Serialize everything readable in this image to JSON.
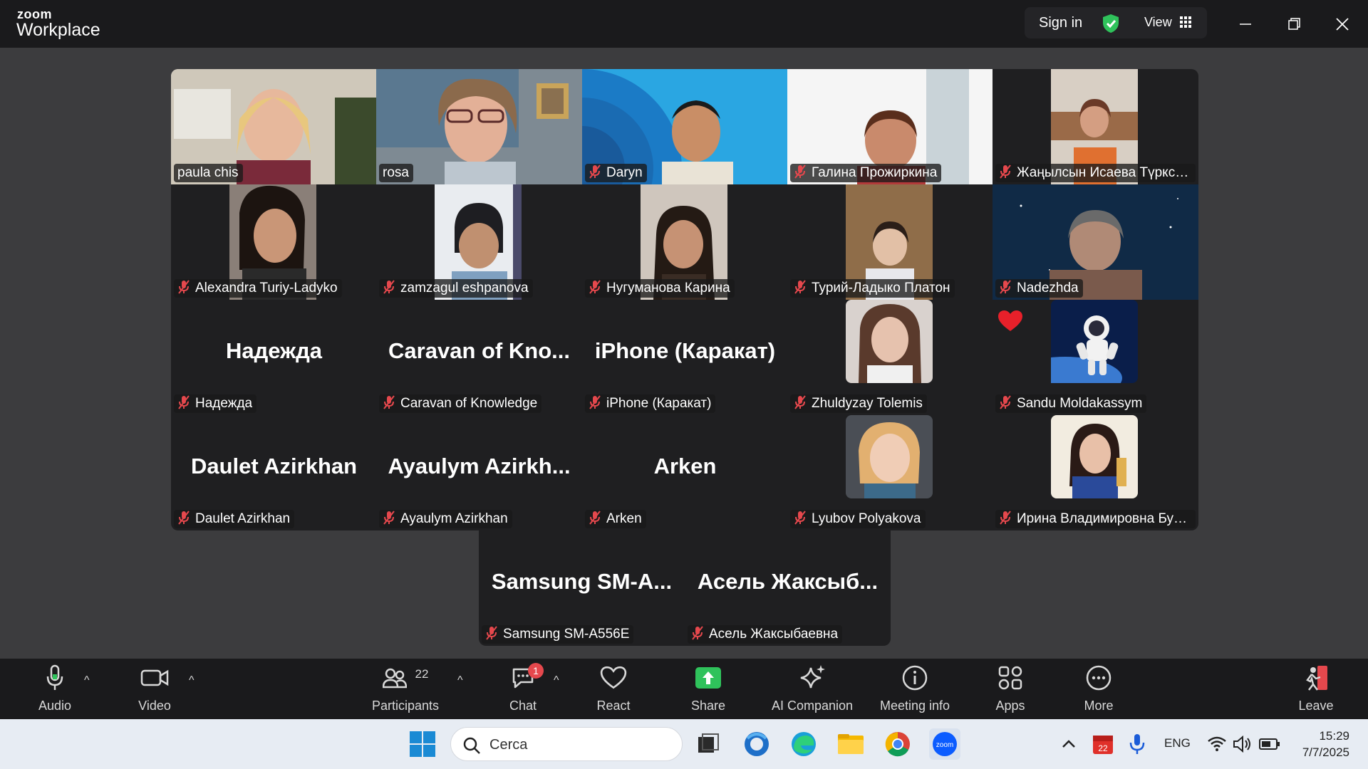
{
  "app": {
    "brand_small": "zoom",
    "brand_large": "Workplace",
    "sign_in": "Sign in",
    "view": "View"
  },
  "participants": [
    {
      "tile": "paula chis",
      "label": "paula chis",
      "muted": false,
      "video": true
    },
    {
      "tile": "rosa",
      "label": "rosa",
      "muted": false,
      "video": true,
      "active_speaker": true
    },
    {
      "tile": "Daryn",
      "label": "Daryn",
      "muted": true,
      "video": true
    },
    {
      "tile": "Галина Прожиркина",
      "label": "Галина Прожиркина",
      "muted": true,
      "video": true
    },
    {
      "tile": "Жаңылсын Исаева Түркси...",
      "label": "Жаңылсын Исаева Түркси...",
      "muted": true,
      "video": true
    },
    {
      "tile": "Alexandra Turiy-Ladyko",
      "label": "Alexandra Turiy-Ladyko",
      "muted": true,
      "video": true
    },
    {
      "tile": "zamzagul eshpanova",
      "label": "zamzagul eshpanova",
      "muted": true,
      "video": true
    },
    {
      "tile": "Нугуманова Карина",
      "label": "Нугуманова Карина",
      "muted": true,
      "video": true
    },
    {
      "tile": "Турий-Ладыко Платон",
      "label": "Турий-Ладыко Платон",
      "muted": true,
      "video": true
    },
    {
      "tile": "Nadezhda",
      "label": "Nadezhda",
      "muted": true,
      "video": true
    },
    {
      "tile": "Надежда",
      "label": "Надежда",
      "muted": true,
      "video": false
    },
    {
      "tile": "Caravan of Kno...",
      "label": "Caravan of Knowledge",
      "muted": true,
      "video": false
    },
    {
      "tile": "iPhone (Каракат)",
      "label": "iPhone (Каракат)",
      "muted": true,
      "video": false
    },
    {
      "tile": "Zhuldyzay Tolemis",
      "label": "Zhuldyzay Tolemis",
      "muted": true,
      "video": true
    },
    {
      "tile": "Sandu Moldakassym",
      "label": "Sandu Moldakassym",
      "muted": true,
      "video": true,
      "reaction": "heart"
    },
    {
      "tile": "Daulet Azirkhan",
      "label": "Daulet Azirkhan",
      "muted": true,
      "video": false
    },
    {
      "tile": "Ayaulym Azirkh...",
      "label": "Ayaulym Azirkhan",
      "muted": true,
      "video": false
    },
    {
      "tile": "Arken",
      "label": "Arken",
      "muted": true,
      "video": false
    },
    {
      "tile": "Lyubov Polyakova",
      "label": "Lyubov Polyakova",
      "muted": true,
      "video": true
    },
    {
      "tile": "Ирина Владимировна Буто...",
      "label": "Ирина Владимировна Буто...",
      "muted": true,
      "video": true
    },
    {
      "tile": "Samsung SM-A...",
      "label": "Samsung SM-A556E",
      "muted": true,
      "video": false
    },
    {
      "tile": "Асель Жаксыб...",
      "label": "Асель Жаксыбаевна",
      "muted": true,
      "video": false
    }
  ],
  "toolbar": {
    "audio": "Audio",
    "video": "Video",
    "participants": "Participants",
    "participants_count": "22",
    "chat": "Chat",
    "chat_badge": "1",
    "react": "React",
    "share": "Share",
    "ai_companion": "AI Companion",
    "meeting_info": "Meeting info",
    "apps": "Apps",
    "more": "More",
    "leave": "Leave"
  },
  "taskbar": {
    "search_placeholder": "Cerca",
    "calendar_badge": "22",
    "language": "ENG",
    "time": "15:29",
    "date": "7/7/2025"
  },
  "colors": {
    "active_speaker": "#2ad571",
    "muted_icon": "#e5484d",
    "share_green": "#2fc25b",
    "leave_red": "#e5484d"
  },
  "icons": [
    "mic-icon",
    "video-camera-icon",
    "participants-icon",
    "chat-icon",
    "heart-outline-icon",
    "share-arrow-icon",
    "sparkle-icon",
    "info-icon",
    "apps-icon",
    "more-dots-icon",
    "leave-icon",
    "shield-check-icon",
    "grid-icon",
    "minimize-icon",
    "restore-icon",
    "close-icon",
    "windows-start-icon",
    "search-icon"
  ]
}
